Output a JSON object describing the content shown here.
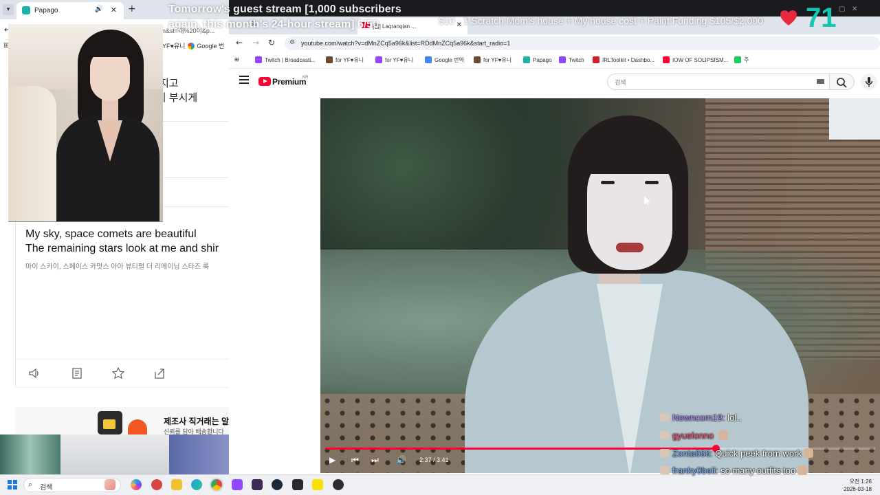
{
  "papago": {
    "tab_label": "Papago",
    "url_fragment": "n&st=대%20이&p...",
    "bookmarks": "YF♥유니",
    "bookmark_google": "Google 번",
    "korean_lines": [
      "게 지고",
      "눈이 부시게"
    ],
    "english_lines": [
      "My sky, space comets are beautiful",
      "The remaining stars look at me and shir"
    ],
    "pronunciation": "마이 스카이, 스페이스 카멋스 아아 뷰티펄 더 리메이닝 스타즈 룩",
    "ad": {
      "title": "제조사 직거래는 알",
      "subtitle": "신뢰를 담아 배송합니다"
    }
  },
  "overlay": {
    "goal_line1": "Tomorrow's guest stream [1,000 subscribers",
    "goal_line2": "again, this month's 24-hour stream] 6/50",
    "ticker": "$10 - 1 Scratch Mom's house + My house cost + Paint Funding $105/$2,000",
    "viewer_count": "71",
    "heart_color": "#e8283c",
    "count_color": "#13c8b3"
  },
  "youtube": {
    "tab_prev_label": "Sc",
    "tab_label": "[컴] Laqranqian ...",
    "url": "youtube.com/watch?v=dMnZCq5a96k&list=RDdMnZCq5a96k&start_radio=1",
    "bookmarks": [
      {
        "label": "Twitch | Broadcasti...",
        "color": "#9146ff"
      },
      {
        "label": "for YF♥유니",
        "color": "#6b4a2f"
      },
      {
        "label": "for YF♥유니",
        "color": "#9146ff"
      },
      {
        "label": "Google 번역",
        "color": "#4285f4"
      },
      {
        "label": "for YF♥유니",
        "color": "#6b4a2f"
      },
      {
        "label": "Papago",
        "color": "#1fb3a5"
      },
      {
        "label": "Twitch",
        "color": "#9146ff"
      },
      {
        "label": "IRLToolkit • Dashbo...",
        "color": "#d11f2b"
      },
      {
        "label": "IOW OF SOLIPSISM...",
        "color": "#ff0033"
      },
      {
        "label": "주",
        "color": "#19ce60"
      }
    ],
    "logo_text": "Premium",
    "logo_region": "KR",
    "search_placeholder": "검색",
    "video": {
      "time": "2:37 / 3:41",
      "progress": 0.7104
    }
  },
  "chat": [
    {
      "user": "Newncorn19:",
      "message": "lol..",
      "color": "#a98bff",
      "emote": false
    },
    {
      "user": "gyuelonno",
      "message": "",
      "color": "#ff4d6d",
      "emote": true
    },
    {
      "user": "Zonta666:",
      "message": "Quick peek from work",
      "color": "#7fb2ff",
      "emote": true
    },
    {
      "user": "franky0beii:",
      "message": "so many outfits too",
      "color": "#7fb2ff",
      "emote": true
    }
  ],
  "taskbar": {
    "search_label": "검색",
    "time": "오전 1:26",
    "date": "2026-03-18"
  }
}
